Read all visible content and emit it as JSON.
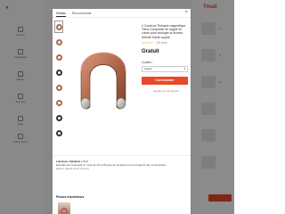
{
  "background": {
    "brand": "Tmall",
    "nav_items": [
      "Accueil",
      "Catégories",
      "Panier",
      "Compte",
      "Aide",
      "Paramètres"
    ],
    "price_tag": "€"
  },
  "modal": {
    "tabs": [
      "Détails",
      "Recommandé"
    ],
    "close_icon": "close-icon",
    "product_title": "4 Couleurs Thérapie magnétique Tiens Composite de bague en cuivre pour soulager la douleur Arthrite Santé supplé",
    "rating_stars": "★★★★☆",
    "rating_count": "(15 avis)",
    "price": "Gratuit",
    "size_label": "Couleur :",
    "size_value": "Argent",
    "buy_label": "Commander",
    "wishlist_label": "♡ Ajouter à mes favoris",
    "description_label": "Livraison standard",
    "description_price": "2,99 €",
    "description_text": "Expédié par l'entrepôt en mois de 15 à 25 jours de livraison pour la majorité des commandes.",
    "sku_text": "Retour gratuit sous 15 jours",
    "buyers_heading": "Photos d'acheteurs"
  },
  "colors": {
    "accent": "#e8492b",
    "copper": "#b0674a",
    "star": "#f2a900"
  }
}
